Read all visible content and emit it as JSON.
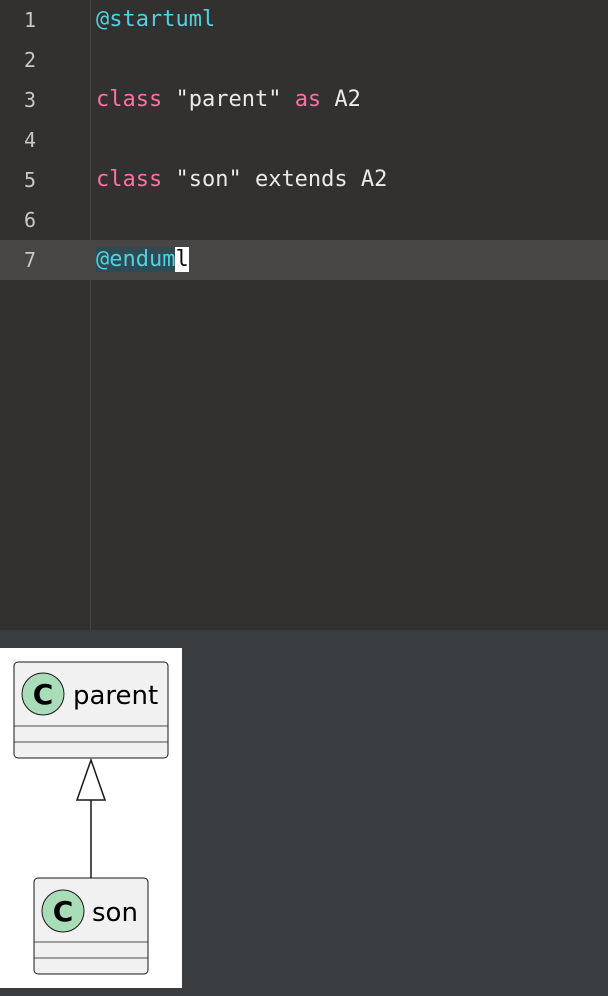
{
  "editor": {
    "lines": [
      {
        "no": "1",
        "parts": [
          {
            "t": "@startuml",
            "c": "kw-at"
          }
        ]
      },
      {
        "no": "2",
        "parts": []
      },
      {
        "no": "3",
        "parts": [
          {
            "t": "class",
            "c": "kw"
          },
          {
            "t": " \"parent\" ",
            "c": "str"
          },
          {
            "t": "as",
            "c": "kw"
          },
          {
            "t": " A2",
            "c": "str"
          }
        ]
      },
      {
        "no": "4",
        "parts": []
      },
      {
        "no": "5",
        "parts": [
          {
            "t": "class",
            "c": "kw"
          },
          {
            "t": " \"son\" extends A2",
            "c": "str"
          }
        ]
      },
      {
        "no": "6",
        "parts": []
      },
      {
        "no": "7",
        "parts": [
          {
            "t": "@endum",
            "c": "kw-at"
          },
          {
            "t": "l",
            "c": "caret-char"
          }
        ]
      }
    ],
    "active_line": 7
  },
  "diagram": {
    "parent_class": {
      "stereotype": "C",
      "name": "parent"
    },
    "child_class": {
      "stereotype": "C",
      "name": "son"
    },
    "relation": "extends"
  },
  "colors": {
    "editor_bg": "#333030",
    "preview_area_bg": "#3a3d40",
    "keyword": "#ff6fa6",
    "directive": "#50d0e0",
    "class_circle": "#a9dcb8"
  }
}
